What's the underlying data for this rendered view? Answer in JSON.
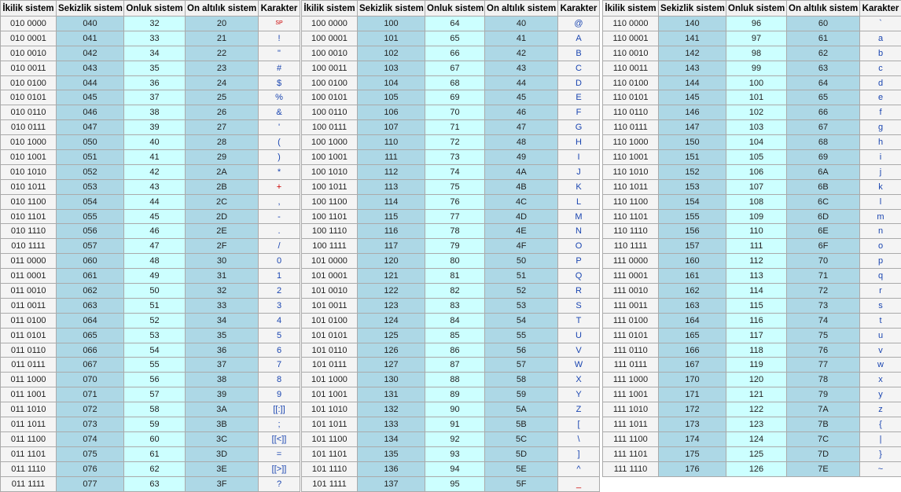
{
  "headers": [
    "İkilik sistem",
    "Sekizlik sistem",
    "Onluk sistem",
    "On altılık sistem",
    "Karakter"
  ],
  "tables": [
    {
      "rows": [
        [
          "010 0000",
          "040",
          "32",
          "20",
          "SP"
        ],
        [
          "010 0001",
          "041",
          "33",
          "21",
          "!"
        ],
        [
          "010 0010",
          "042",
          "34",
          "22",
          "\""
        ],
        [
          "010 0011",
          "043",
          "35",
          "23",
          "#"
        ],
        [
          "010 0100",
          "044",
          "36",
          "24",
          "$"
        ],
        [
          "010 0101",
          "045",
          "37",
          "25",
          "%"
        ],
        [
          "010 0110",
          "046",
          "38",
          "26",
          "&"
        ],
        [
          "010 0111",
          "047",
          "39",
          "27",
          "'"
        ],
        [
          "010 1000",
          "050",
          "40",
          "28",
          "("
        ],
        [
          "010 1001",
          "051",
          "41",
          "29",
          ")"
        ],
        [
          "010 1010",
          "052",
          "42",
          "2A",
          "*"
        ],
        [
          "010 1011",
          "053",
          "43",
          "2B",
          "+"
        ],
        [
          "010 1100",
          "054",
          "44",
          "2C",
          ","
        ],
        [
          "010 1101",
          "055",
          "45",
          "2D",
          "-"
        ],
        [
          "010 1110",
          "056",
          "46",
          "2E",
          "."
        ],
        [
          "010 1111",
          "057",
          "47",
          "2F",
          "/"
        ],
        [
          "011 0000",
          "060",
          "48",
          "30",
          "0"
        ],
        [
          "011 0001",
          "061",
          "49",
          "31",
          "1"
        ],
        [
          "011 0010",
          "062",
          "50",
          "32",
          "2"
        ],
        [
          "011 0011",
          "063",
          "51",
          "33",
          "3"
        ],
        [
          "011 0100",
          "064",
          "52",
          "34",
          "4"
        ],
        [
          "011 0101",
          "065",
          "53",
          "35",
          "5"
        ],
        [
          "011 0110",
          "066",
          "54",
          "36",
          "6"
        ],
        [
          "011 0111",
          "067",
          "55",
          "37",
          "7"
        ],
        [
          "011 1000",
          "070",
          "56",
          "38",
          "8"
        ],
        [
          "011 1001",
          "071",
          "57",
          "39",
          "9"
        ],
        [
          "011 1010",
          "072",
          "58",
          "3A",
          "[[:]]"
        ],
        [
          "011 1011",
          "073",
          "59",
          "3B",
          ";"
        ],
        [
          "011 1100",
          "074",
          "60",
          "3C",
          "[[<]]"
        ],
        [
          "011 1101",
          "075",
          "61",
          "3D",
          "="
        ],
        [
          "011 1110",
          "076",
          "62",
          "3E",
          "[[>]]"
        ],
        [
          "011 1111",
          "077",
          "63",
          "3F",
          "?"
        ]
      ]
    },
    {
      "rows": [
        [
          "100 0000",
          "100",
          "64",
          "40",
          "@"
        ],
        [
          "100 0001",
          "101",
          "65",
          "41",
          "A"
        ],
        [
          "100 0010",
          "102",
          "66",
          "42",
          "B"
        ],
        [
          "100 0011",
          "103",
          "67",
          "43",
          "C"
        ],
        [
          "100 0100",
          "104",
          "68",
          "44",
          "D"
        ],
        [
          "100 0101",
          "105",
          "69",
          "45",
          "E"
        ],
        [
          "100 0110",
          "106",
          "70",
          "46",
          "F"
        ],
        [
          "100 0111",
          "107",
          "71",
          "47",
          "G"
        ],
        [
          "100 1000",
          "110",
          "72",
          "48",
          "H"
        ],
        [
          "100 1001",
          "111",
          "73",
          "49",
          "I"
        ],
        [
          "100 1010",
          "112",
          "74",
          "4A",
          "J"
        ],
        [
          "100 1011",
          "113",
          "75",
          "4B",
          "K"
        ],
        [
          "100 1100",
          "114",
          "76",
          "4C",
          "L"
        ],
        [
          "100 1101",
          "115",
          "77",
          "4D",
          "M"
        ],
        [
          "100 1110",
          "116",
          "78",
          "4E",
          "N"
        ],
        [
          "100 1111",
          "117",
          "79",
          "4F",
          "O"
        ],
        [
          "101 0000",
          "120",
          "80",
          "50",
          "P"
        ],
        [
          "101 0001",
          "121",
          "81",
          "51",
          "Q"
        ],
        [
          "101 0010",
          "122",
          "82",
          "52",
          "R"
        ],
        [
          "101 0011",
          "123",
          "83",
          "53",
          "S"
        ],
        [
          "101 0100",
          "124",
          "84",
          "54",
          "T"
        ],
        [
          "101 0101",
          "125",
          "85",
          "55",
          "U"
        ],
        [
          "101 0110",
          "126",
          "86",
          "56",
          "V"
        ],
        [
          "101 0111",
          "127",
          "87",
          "57",
          "W"
        ],
        [
          "101 1000",
          "130",
          "88",
          "58",
          "X"
        ],
        [
          "101 1001",
          "131",
          "89",
          "59",
          "Y"
        ],
        [
          "101 1010",
          "132",
          "90",
          "5A",
          "Z"
        ],
        [
          "101 1011",
          "133",
          "91",
          "5B",
          "["
        ],
        [
          "101 1100",
          "134",
          "92",
          "5C",
          "\\"
        ],
        [
          "101 1101",
          "135",
          "93",
          "5D",
          "]"
        ],
        [
          "101 1110",
          "136",
          "94",
          "5E",
          "^"
        ],
        [
          "101 1111",
          "137",
          "95",
          "5F",
          "_"
        ]
      ]
    },
    {
      "rows": [
        [
          "110 0000",
          "140",
          "96",
          "60",
          "`"
        ],
        [
          "110 0001",
          "141",
          "97",
          "61",
          "a"
        ],
        [
          "110 0010",
          "142",
          "98",
          "62",
          "b"
        ],
        [
          "110 0011",
          "143",
          "99",
          "63",
          "c"
        ],
        [
          "110 0100",
          "144",
          "100",
          "64",
          "d"
        ],
        [
          "110 0101",
          "145",
          "101",
          "65",
          "e"
        ],
        [
          "110 0110",
          "146",
          "102",
          "66",
          "f"
        ],
        [
          "110 0111",
          "147",
          "103",
          "67",
          "g"
        ],
        [
          "110 1000",
          "150",
          "104",
          "68",
          "h"
        ],
        [
          "110 1001",
          "151",
          "105",
          "69",
          "i"
        ],
        [
          "110 1010",
          "152",
          "106",
          "6A",
          "j"
        ],
        [
          "110 1011",
          "153",
          "107",
          "6B",
          "k"
        ],
        [
          "110 1100",
          "154",
          "108",
          "6C",
          "l"
        ],
        [
          "110 1101",
          "155",
          "109",
          "6D",
          "m"
        ],
        [
          "110 1110",
          "156",
          "110",
          "6E",
          "n"
        ],
        [
          "110 1111",
          "157",
          "111",
          "6F",
          "o"
        ],
        [
          "111 0000",
          "160",
          "112",
          "70",
          "p"
        ],
        [
          "111 0001",
          "161",
          "113",
          "71",
          "q"
        ],
        [
          "111 0010",
          "162",
          "114",
          "72",
          "r"
        ],
        [
          "111 0011",
          "163",
          "115",
          "73",
          "s"
        ],
        [
          "111 0100",
          "164",
          "116",
          "74",
          "t"
        ],
        [
          "111 0101",
          "165",
          "117",
          "75",
          "u"
        ],
        [
          "111 0110",
          "166",
          "118",
          "76",
          "v"
        ],
        [
          "111 0111",
          "167",
          "119",
          "77",
          "w"
        ],
        [
          "111 1000",
          "170",
          "120",
          "78",
          "x"
        ],
        [
          "111 1001",
          "171",
          "121",
          "79",
          "y"
        ],
        [
          "111 1010",
          "172",
          "122",
          "7A",
          "z"
        ],
        [
          "111 1011",
          "173",
          "123",
          "7B",
          "{"
        ],
        [
          "111 1100",
          "174",
          "124",
          "7C",
          "|"
        ],
        [
          "111 1101",
          "175",
          "125",
          "7D",
          "}"
        ],
        [
          "111 1110",
          "176",
          "126",
          "7E",
          "~"
        ]
      ]
    }
  ],
  "colors": {
    "header_bg": "#f2f2f2",
    "binary_bg": "#f4f4f4",
    "octal_bg": "#add8e6",
    "decimal_bg": "#ccffff",
    "hex_bg": "#add8e6",
    "char_color": "#1a45b0",
    "char_red": "#cc0000",
    "border": "#aaaaaa"
  }
}
